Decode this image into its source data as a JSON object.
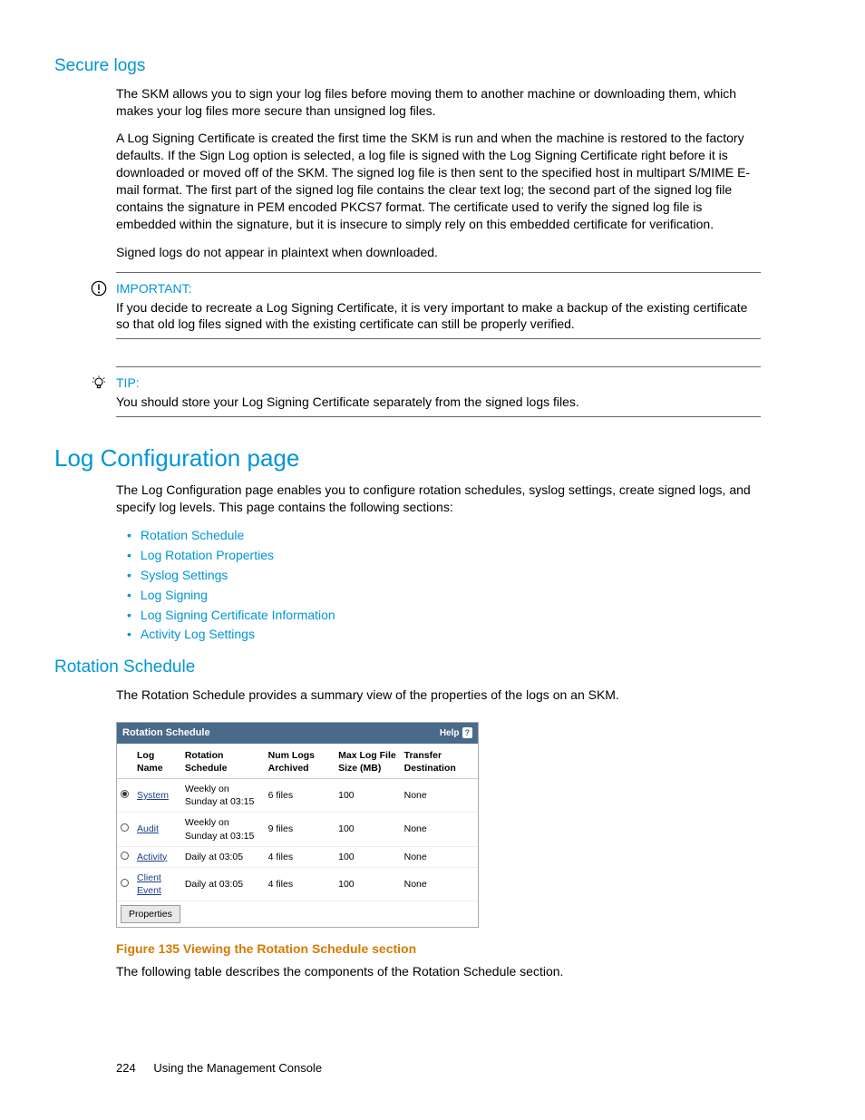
{
  "sections": {
    "secure_logs": {
      "title": "Secure logs",
      "p1": "The SKM allows you to sign your log files before moving them to another machine or downloading them, which makes your log files more secure than unsigned log files.",
      "p2": "A Log Signing Certificate is created the first time the SKM is run and when the machine is restored to the factory defaults. If the Sign Log option is selected, a log file is signed with the Log Signing Certificate right before it is downloaded or moved off of the SKM. The signed log file is then sent to the specified host in multipart S/MIME E-mail format. The first part of the signed log file contains the clear text log; the second part of the signed log file contains the signature in PEM encoded PKCS7 format. The certificate used to verify the signed log file is embedded within the signature, but it is insecure to simply rely on this embedded certificate for verification.",
      "p3": "Signed logs do not appear in plaintext when downloaded."
    },
    "important": {
      "label": "IMPORTANT:",
      "text": "If you decide to recreate a Log Signing Certificate, it is very important to make a backup of the existing certificate so that old log files signed with the existing certificate can still be properly verified."
    },
    "tip": {
      "label": "TIP:",
      "text": "You should store your Log Signing Certificate separately from the signed logs files."
    },
    "log_config": {
      "title": "Log Configuration page",
      "intro": "The Log Configuration page enables you to configure rotation schedules, syslog settings, create signed logs, and specify log levels. This page contains the following sections:",
      "links": [
        "Rotation Schedule",
        "Log Rotation Properties",
        "Syslog Settings",
        "Log Signing",
        "Log Signing Certificate Information",
        "Activity Log Settings"
      ]
    },
    "rotation": {
      "title": "Rotation Schedule",
      "intro": "The Rotation Schedule provides a summary view of the properties of the logs on an SKM."
    }
  },
  "figure": {
    "panel_title": "Rotation Schedule",
    "help": "Help",
    "headers": {
      "log_name": "Log Name",
      "rotation_schedule": "Rotation Schedule",
      "num_logs": "Num Logs Archived",
      "max_size": "Max Log File Size (MB)",
      "transfer": "Transfer Destination"
    },
    "rows": [
      {
        "selected": true,
        "name": "System",
        "schedule": "Weekly on Sunday at 03:15",
        "num": "6 files",
        "size": "100",
        "dest": "None"
      },
      {
        "selected": false,
        "name": "Audit",
        "schedule": "Weekly on Sunday at 03:15",
        "num": "9 files",
        "size": "100",
        "dest": "None"
      },
      {
        "selected": false,
        "name": "Activity",
        "schedule": "Daily at 03:05",
        "num": "4 files",
        "size": "100",
        "dest": "None"
      },
      {
        "selected": false,
        "name": "Client Event",
        "schedule": "Daily at 03:05",
        "num": "4 files",
        "size": "100",
        "dest": "None"
      }
    ],
    "button": "Properties",
    "caption": "Figure 135 Viewing the Rotation Schedule section",
    "after": "The following table describes the components of the Rotation Schedule section."
  },
  "footer": {
    "page": "224",
    "text": "Using the Management Console"
  }
}
